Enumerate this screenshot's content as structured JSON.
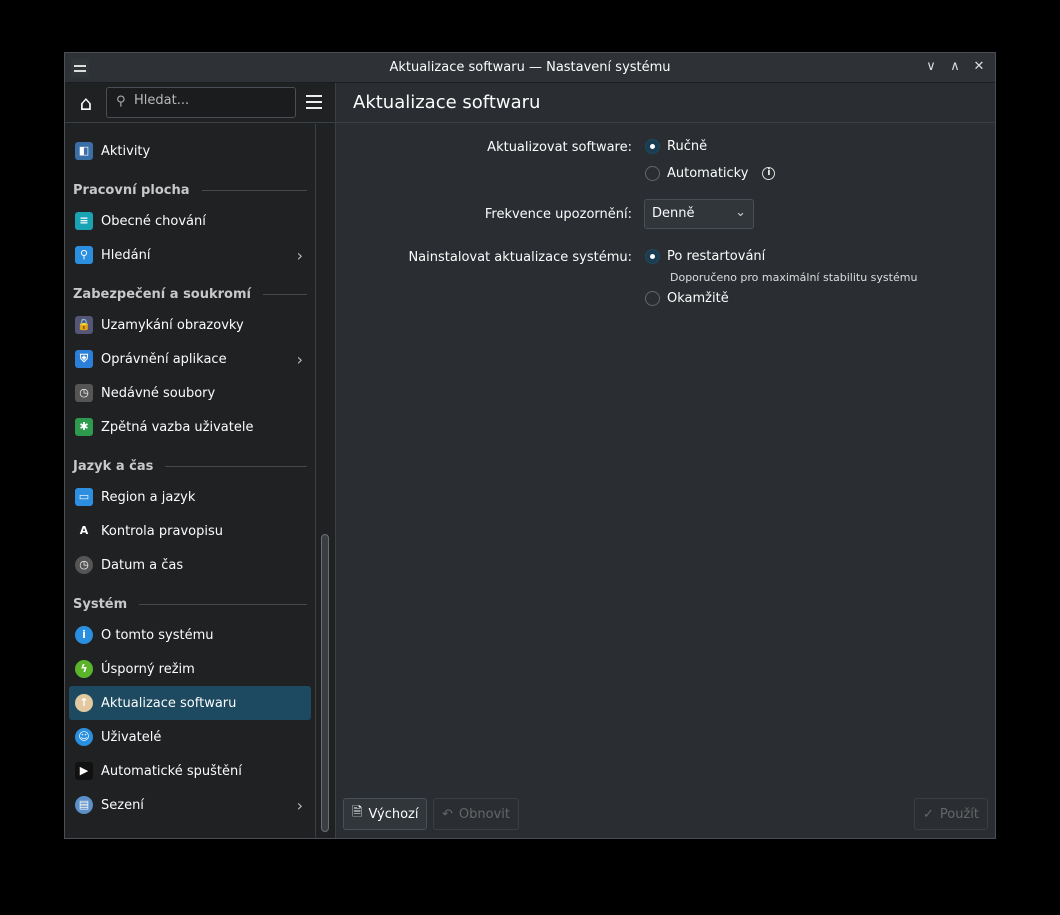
{
  "window": {
    "title": "Aktualizace softwaru — Nastavení systému",
    "buttons": [
      "minimize",
      "maximize",
      "close"
    ]
  },
  "sidebar": {
    "search_placeholder": "Hledat...",
    "items_top": [
      {
        "label": "Aktivity",
        "icon": "activities-icon"
      }
    ],
    "groups": [
      {
        "title": "Pracovní plocha",
        "items": [
          {
            "label": "Obecné chování"
          },
          {
            "label": "Hledání",
            "chevron": true
          }
        ]
      },
      {
        "title": "Zabezpečení a soukromí",
        "items": [
          {
            "label": "Uzamykání obrazovky"
          },
          {
            "label": "Oprávnění aplikace",
            "chevron": true
          },
          {
            "label": "Nedávné soubory"
          },
          {
            "label": "Zpětná vazba uživatele"
          }
        ]
      },
      {
        "title": "Jazyk a čas",
        "items": [
          {
            "label": "Region a jazyk"
          },
          {
            "label": "Kontrola pravopisu"
          },
          {
            "label": "Datum a čas"
          }
        ]
      },
      {
        "title": "Systém",
        "items": [
          {
            "label": "O tomto systému"
          },
          {
            "label": "Úsporný režim"
          },
          {
            "label": "Aktualizace softwaru",
            "selected": true
          },
          {
            "label": "Uživatelé"
          },
          {
            "label": "Automatické spuštění"
          },
          {
            "label": "Sezení",
            "chevron": true
          }
        ]
      }
    ]
  },
  "main": {
    "title": "Aktualizace softwaru",
    "update_label": "Aktualizovat software:",
    "update_manual": "Ručně",
    "update_auto": "Automaticky",
    "freq_label": "Frekvence upozornění:",
    "freq_value": "Denně",
    "install_label": "Nainstalovat aktualizace systému:",
    "install_restart": "Po restartování",
    "install_hint": "Doporučeno pro maximální stabilitu systému",
    "install_now": "Okamžitě"
  },
  "footer": {
    "defaults": "Výchozí",
    "reset": "Obnovit",
    "apply": "Použít"
  }
}
